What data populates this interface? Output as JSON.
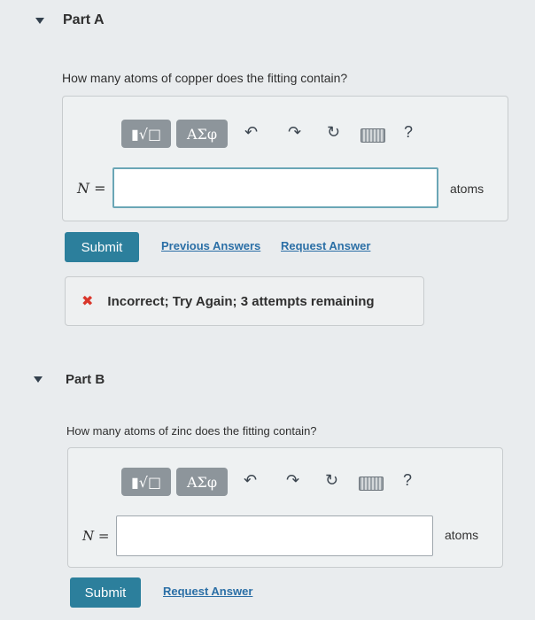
{
  "partA": {
    "title": "Part A",
    "question": "How many atoms of copper does the fitting contain?",
    "toolbar": {
      "template_symbol": "▮√□",
      "greek_symbol": "ΑΣφ",
      "help_symbol": "?"
    },
    "variable_label": "N =",
    "input_value": "",
    "unit": "atoms",
    "submit_label": "Submit",
    "previous_answers_label": "Previous Answers",
    "request_answer_label": "Request Answer",
    "feedback": {
      "icon": "✖",
      "text": "Incorrect; Try Again; 3 attempts remaining"
    }
  },
  "partB": {
    "title": "Part B",
    "question": "How many atoms of zinc does the fitting contain?",
    "toolbar": {
      "template_symbol": "▮√□",
      "greek_symbol": "ΑΣφ",
      "help_symbol": "?"
    },
    "variable_label": "N =",
    "input_value": "",
    "unit": "atoms",
    "submit_label": "Submit",
    "request_answer_label": "Request Answer"
  },
  "colors": {
    "accent": "#2c7f9c",
    "link": "#2b6fa6",
    "error": "#d9362b"
  }
}
